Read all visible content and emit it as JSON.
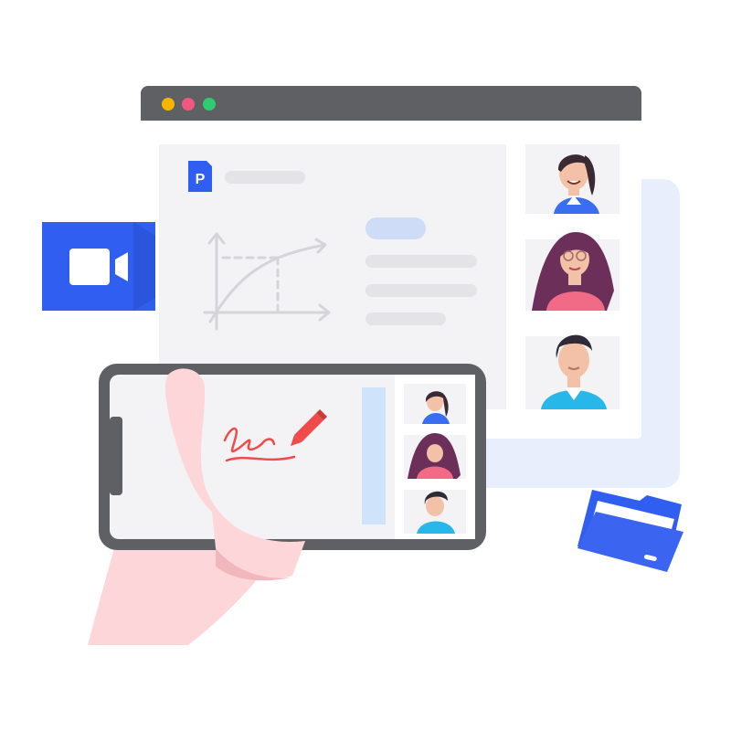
{
  "colors": {
    "background": "#ffffff",
    "window_bar": "#5f6064",
    "window_body": "#f3f3f6",
    "window_shadow": "#e9eefc",
    "placeholder_grey": "#e4e4e8",
    "accent_blue": "#2f5ef0",
    "pill_blue": "#cfdcf7",
    "dot_yellow": "#f7b500",
    "dot_pink": "#f2577f",
    "dot_green": "#2ecb71",
    "phone_frame": "#5f6064",
    "signature_red": "#f04b4b",
    "hand_pink": "#fdd6d9",
    "folder_blue": "#3b64f0"
  },
  "icons": [
    "window-close-dot",
    "window-minimize-dot",
    "window-maximize-dot",
    "document-p-icon",
    "chart-graph-icon",
    "video-camera-icon",
    "signature-pen-icon",
    "folder-icon"
  ],
  "participants": [
    {
      "name_slot": "participant-woman-ponytail",
      "shirt": "#3a6ef0"
    },
    {
      "name_slot": "participant-woman-glasses",
      "shirt": "#f26b86"
    },
    {
      "name_slot": "participant-man",
      "shirt": "#27b7e8"
    }
  ]
}
